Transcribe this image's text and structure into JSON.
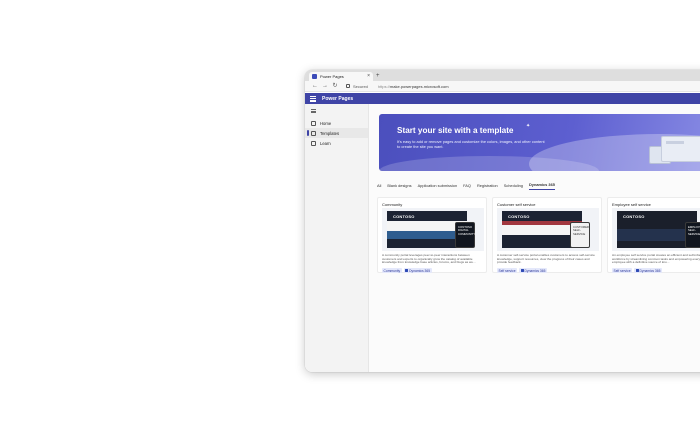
{
  "browser": {
    "tab_title": "Power Pages",
    "tab_close": "×",
    "new_tab": "+",
    "back": "←",
    "forward": "→",
    "refresh": "↻",
    "secured_label": "Secured",
    "url_scheme": "https://",
    "url_rest": "make.powerpages.microsoft.com"
  },
  "app": {
    "name": "Power Pages",
    "accent": "#3f44a6"
  },
  "sidebar": {
    "items": [
      {
        "label": "Home",
        "icon": "home-icon",
        "active": false
      },
      {
        "label": "Templates",
        "icon": "templates-icon",
        "active": true
      },
      {
        "label": "Learn",
        "icon": "learn-icon",
        "active": false
      }
    ]
  },
  "hero": {
    "title": "Start your site with a template",
    "description": "It's easy to add or remove pages and customize the colors, images, and other content to create the site you want."
  },
  "filters": {
    "items": [
      "All",
      "Blank designs",
      "Application submission",
      "FAQ",
      "Registration",
      "Scheduling",
      "Dynamics 365"
    ],
    "active": "Dynamics 365"
  },
  "cards": [
    {
      "title": "Community",
      "brand": "CONTOSO",
      "phone_text": "CONTOSO DIGITAL COMMUNITY",
      "description": "A community portal leverages peer-to-peer interactions between customers and experts to organically grow the catalog of available knowledge from knowledge base articles, forums, and blogs as we...",
      "tags": [
        "Community",
        "Dynamics 365"
      ]
    },
    {
      "title": "Customer self service",
      "brand": "CONTOSO",
      "phone_text": "CUSTOMER SELF-SERVICE",
      "description": "A customer self-service portal enables customers to access self-service knowledge, support resources, view the progress of their cases and provide feedback.",
      "tags": [
        "Self service",
        "Dynamics 365"
      ]
    },
    {
      "title": "Employee self service",
      "brand": "CONTOSO",
      "phone_text": "EMPLOYEE SELF-SERVICE",
      "description": "An employee self service portal creates an efficient and self-informed workforce by streamlining common tasks and empowering every employee with a definitive source of kno...",
      "tags": [
        "Self service",
        "Dynamics 365"
      ]
    }
  ]
}
